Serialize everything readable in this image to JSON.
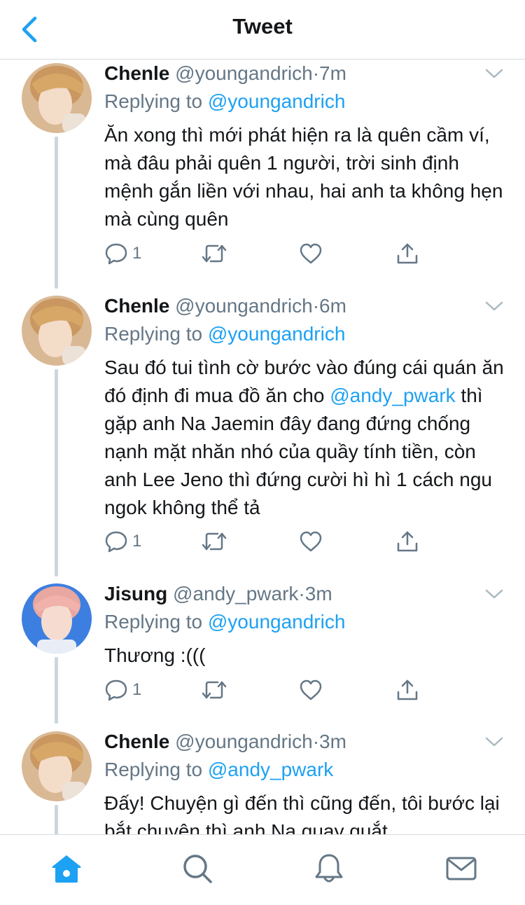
{
  "header": {
    "title": "Tweet"
  },
  "colors": {
    "accent": "#1da1f2",
    "secondary_text": "#657786",
    "divider": "#d6dbdf"
  },
  "tweets": [
    {
      "name": "Chenle",
      "handle": "@youngandrich",
      "dot": "·",
      "time": "7m",
      "replying_prefix": "Replying to",
      "replying_to": "@youngandrich",
      "text": "Ăn xong thì mới phát hiện ra là quên cầm ví, mà đâu phải quên 1 người, trời sinh định mệnh gắn liền với nhau, hai anh ta không hẹn mà cùng quên",
      "reply_count": "1",
      "avatar": "chenle-avatar"
    },
    {
      "name": "Chenle",
      "handle": "@youngandrich",
      "dot": "·",
      "time": "6m",
      "replying_prefix": "Replying to",
      "replying_to": "@youngandrich",
      "text_mention": "@andy_pwark",
      "text_before": "Sau đó tui tình cờ bước vào đúng cái quán ăn đó định đi mua đồ ăn cho ",
      "text_after": " thì gặp anh Na Jaemin đây đang đứng chống nạnh mặt nhăn nhó của quầy tính tiền, còn anh Lee Jeno thì đứng cười hì hì 1 cách ngu ngok không thể tả",
      "reply_count": "1",
      "avatar": "chenle-avatar"
    },
    {
      "name": "Jisung",
      "handle": "@andy_pwark",
      "dot": "·",
      "time": "3m",
      "replying_prefix": "Replying to",
      "replying_to": "@youngandrich",
      "text": "Thương :(((",
      "reply_count": "1",
      "avatar": "jisung-avatar"
    },
    {
      "name": "Chenle",
      "handle": "@youngandrich",
      "dot": "·",
      "time": "3m",
      "replying_prefix": "Replying to",
      "replying_to": "@andy_pwark",
      "text": "Đấy! Chuyện gì đến thì cũng đến, tôi bước lại bắt chuyện thì anh Na quay quắt",
      "avatar": "chenle-avatar"
    }
  ],
  "icons": {
    "back": "chevron-left-icon",
    "more": "chevron-down-icon",
    "reply": "comment-icon",
    "retweet": "retweet-icon",
    "like": "heart-icon",
    "share": "share-icon"
  },
  "tabbar": {
    "items": [
      "home-icon",
      "search-icon",
      "notifications-icon",
      "messages-icon"
    ],
    "active": "home-icon"
  }
}
